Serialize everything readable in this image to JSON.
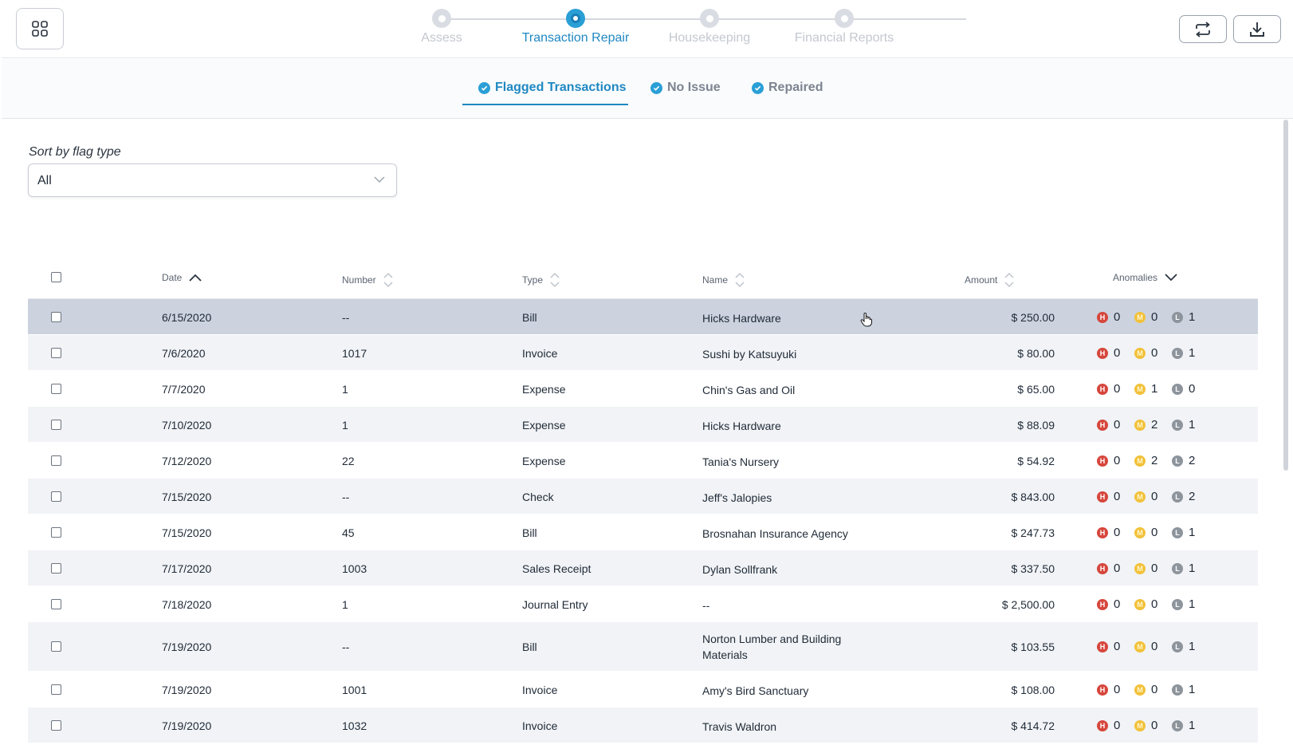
{
  "header": {
    "steps": [
      {
        "label": "Assess",
        "active": false
      },
      {
        "label": "Transaction Repair",
        "active": true
      },
      {
        "label": "Housekeeping",
        "active": false
      },
      {
        "label": "Financial Reports",
        "active": false
      }
    ],
    "icons": {
      "apps": "grid-apps-icon",
      "refresh": "refresh-icon",
      "download": "download-icon"
    }
  },
  "subtabs": [
    {
      "label": "Flagged Transactions",
      "active": true
    },
    {
      "label": "No Issue",
      "active": false
    },
    {
      "label": "Repaired",
      "active": false
    }
  ],
  "filter": {
    "label": "Sort by flag type",
    "value": "All"
  },
  "table": {
    "columns": {
      "date": "Date",
      "number": "Number",
      "type": "Type",
      "name": "Name",
      "amount": "Amount",
      "anomalies": "Anomalies"
    },
    "badges": {
      "high": "H",
      "medium": "M",
      "low": "L"
    },
    "rows": [
      {
        "date": "6/15/2020",
        "number": "--",
        "type": "Bill",
        "name": "Hicks Hardware",
        "amount": "$ 250.00",
        "h": "0",
        "m": "0",
        "l": "1"
      },
      {
        "date": "7/6/2020",
        "number": "1017",
        "type": "Invoice",
        "name": "Sushi by Katsuyuki",
        "amount": "$ 80.00",
        "h": "0",
        "m": "0",
        "l": "1"
      },
      {
        "date": "7/7/2020",
        "number": "1",
        "type": "Expense",
        "name": "Chin's Gas and Oil",
        "amount": "$ 65.00",
        "h": "0",
        "m": "1",
        "l": "0"
      },
      {
        "date": "7/10/2020",
        "number": "1",
        "type": "Expense",
        "name": "Hicks Hardware",
        "amount": "$ 88.09",
        "h": "0",
        "m": "2",
        "l": "1"
      },
      {
        "date": "7/12/2020",
        "number": "22",
        "type": "Expense",
        "name": "Tania's Nursery",
        "amount": "$ 54.92",
        "h": "0",
        "m": "2",
        "l": "2"
      },
      {
        "date": "7/15/2020",
        "number": "--",
        "type": "Check",
        "name": "Jeff's Jalopies",
        "amount": "$ 843.00",
        "h": "0",
        "m": "0",
        "l": "2"
      },
      {
        "date": "7/15/2020",
        "number": "45",
        "type": "Bill",
        "name": "Brosnahan Insurance Agency",
        "amount": "$ 247.73",
        "h": "0",
        "m": "0",
        "l": "1"
      },
      {
        "date": "7/17/2020",
        "number": "1003",
        "type": "Sales Receipt",
        "name": "Dylan Sollfrank",
        "amount": "$ 337.50",
        "h": "0",
        "m": "0",
        "l": "1"
      },
      {
        "date": "7/18/2020",
        "number": "1",
        "type": "Journal Entry",
        "name": "--",
        "amount": "$ 2,500.00",
        "h": "0",
        "m": "0",
        "l": "1"
      },
      {
        "date": "7/19/2020",
        "number": "--",
        "type": "Bill",
        "name": "Norton Lumber and Building Materials",
        "amount": "$ 103.55",
        "h": "0",
        "m": "0",
        "l": "1"
      },
      {
        "date": "7/19/2020",
        "number": "1001",
        "type": "Invoice",
        "name": "Amy's Bird Sanctuary",
        "amount": "$ 108.00",
        "h": "0",
        "m": "0",
        "l": "1"
      },
      {
        "date": "7/19/2020",
        "number": "1032",
        "type": "Invoice",
        "name": "Travis Waldron",
        "amount": "$ 414.72",
        "h": "0",
        "m": "0",
        "l": "1"
      }
    ]
  }
}
